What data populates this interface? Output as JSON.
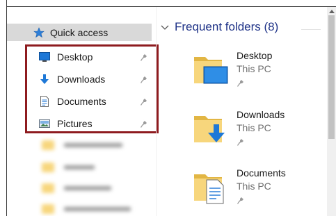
{
  "navigation": {
    "quick_access_label": "Quick access",
    "pinned_items": [
      {
        "label": "Desktop",
        "icon": "desktop-icon"
      },
      {
        "label": "Downloads",
        "icon": "downloads-arrow-icon"
      },
      {
        "label": "Documents",
        "icon": "document-icon"
      },
      {
        "label": "Pictures",
        "icon": "pictures-icon"
      }
    ]
  },
  "content": {
    "group_header": "Frequent folders (8)",
    "folders": [
      {
        "name": "Desktop",
        "location": "This PC"
      },
      {
        "name": "Downloads",
        "location": "This PC"
      },
      {
        "name": "Documents",
        "location": "This PC"
      }
    ]
  },
  "colors": {
    "highlight_border": "#8e1b1f",
    "quick_access_selected_bg": "#d9d9d9",
    "group_header_text": "#1e3287",
    "folder_yellow": "#f7d67c",
    "accent_blue": "#1e78d7"
  }
}
